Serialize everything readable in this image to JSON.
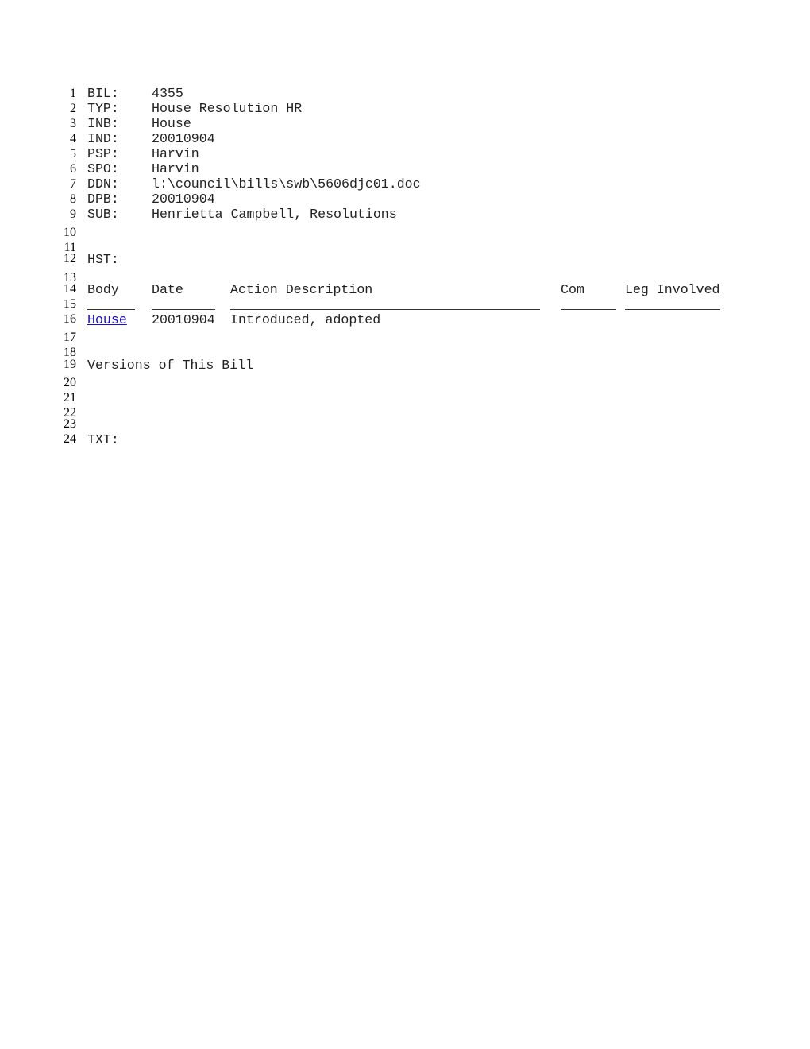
{
  "fields": [
    {
      "num": "1",
      "label": "BIL:",
      "value": "4355"
    },
    {
      "num": "2",
      "label": "TYP:",
      "value": "House Resolution HR"
    },
    {
      "num": "3",
      "label": "INB:",
      "value": "House"
    },
    {
      "num": "4",
      "label": "IND:",
      "value": "20010904"
    },
    {
      "num": "5",
      "label": "PSP:",
      "value": "Harvin"
    },
    {
      "num": "6",
      "label": "SPO:",
      "value": "Harvin"
    },
    {
      "num": "7",
      "label": "DDN:",
      "value": "l:\\council\\bills\\swb\\5606djc01.doc"
    },
    {
      "num": "8",
      "label": "DPB:",
      "value": "20010904"
    },
    {
      "num": "9",
      "label": "SUB:",
      "value": "Henrietta Campbell, Resolutions"
    }
  ],
  "line_numbers": [
    "10",
    "11",
    "12",
    "13",
    "14",
    "15",
    "16",
    "17",
    "18",
    "19",
    "20",
    "21",
    "22",
    "23",
    "24"
  ],
  "history": {
    "label": "HST:",
    "columns": [
      "Body",
      "Date",
      "Action Description",
      "Com",
      "Leg Involved"
    ],
    "rows": [
      {
        "body": "House",
        "date": "20010904",
        "action": "Introduced, adopted",
        "com": "",
        "leg": ""
      }
    ]
  },
  "versions_heading": "Versions of This Bill",
  "text_label": "TXT:"
}
